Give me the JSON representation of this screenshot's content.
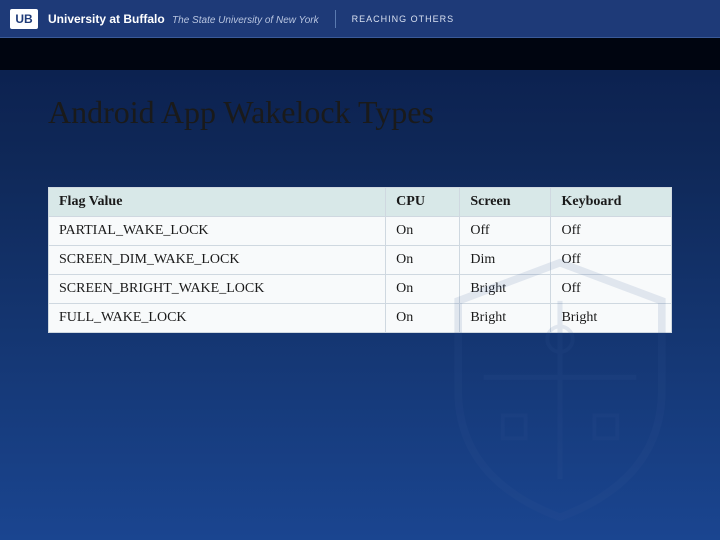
{
  "header": {
    "logo_text": "UB",
    "university": "University at Buffalo",
    "suny": "The State University of New York",
    "tagline": "REACHING OTHERS"
  },
  "title": "Android App Wakelock Types",
  "chart_data": {
    "type": "table",
    "headers": [
      "Flag Value",
      "CPU",
      "Screen",
      "Keyboard"
    ],
    "rows": [
      [
        "PARTIAL_WAKE_LOCK",
        "On",
        "Off",
        "Off"
      ],
      [
        "SCREEN_DIM_WAKE_LOCK",
        "On",
        "Dim",
        "Off"
      ],
      [
        "SCREEN_BRIGHT_WAKE_LOCK",
        "On",
        "Bright",
        "Off"
      ],
      [
        "FULL_WAKE_LOCK",
        "On",
        "Bright",
        "Bright"
      ]
    ]
  }
}
